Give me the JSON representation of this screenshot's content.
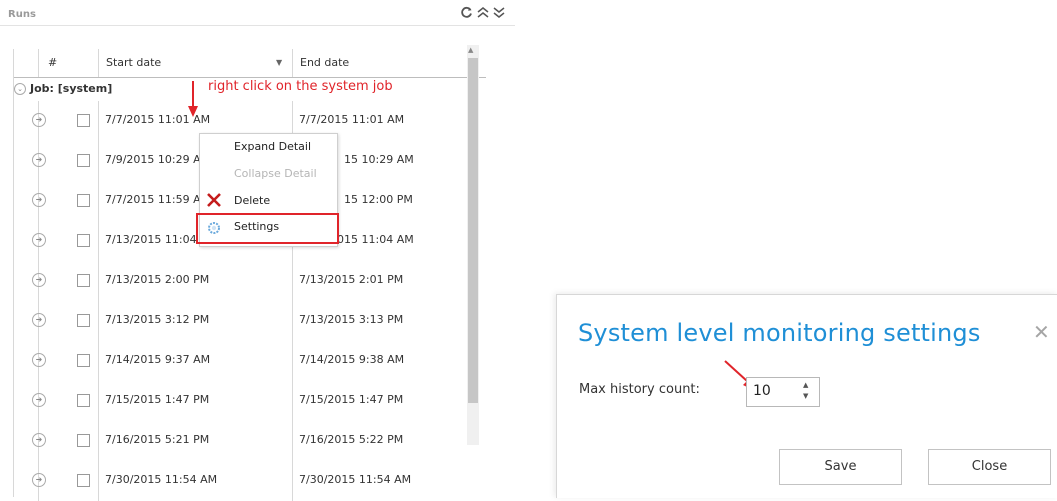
{
  "panel": {
    "title": "Runs",
    "icons": [
      "refresh-icon",
      "collapse-all-icon",
      "expand-all-icon"
    ]
  },
  "grid": {
    "columns": [
      "#",
      "Start date",
      "End date"
    ],
    "job_group_label": "Job: [system]",
    "rows": [
      {
        "start": "7/7/2015 11:01 AM",
        "end": "7/7/2015 11:01 AM"
      },
      {
        "start": "7/9/2015 10:29 A",
        "end": "15 10:29 AM"
      },
      {
        "start": "7/7/2015 11:59 A",
        "end": "15 12:00 PM"
      },
      {
        "start": "7/13/2015 11:04",
        "end": "015 11:04 AM"
      },
      {
        "start": "7/13/2015 2:00 PM",
        "end": "7/13/2015 2:01 PM"
      },
      {
        "start": "7/13/2015 3:12 PM",
        "end": "7/13/2015 3:13 PM"
      },
      {
        "start": "7/14/2015 9:37 AM",
        "end": "7/14/2015 9:38 AM"
      },
      {
        "start": "7/15/2015 1:47 PM",
        "end": "7/15/2015 1:47 PM"
      },
      {
        "start": "7/16/2015 5:21 PM",
        "end": "7/16/2015 5:22 PM"
      },
      {
        "start": "7/30/2015 11:54 AM",
        "end": "7/30/2015 11:54 AM"
      }
    ]
  },
  "context_menu": {
    "items": [
      {
        "label": "Expand Detail",
        "enabled": true
      },
      {
        "label": "Collapse Detail",
        "enabled": false
      },
      {
        "label": "Delete",
        "enabled": true,
        "icon": "delete-x-icon"
      },
      {
        "label": "Settings",
        "enabled": true,
        "icon": "settings-gear-icon"
      }
    ]
  },
  "annotation": {
    "text": "right click on the system job",
    "color": "#e0242a"
  },
  "dialog": {
    "title": "System level monitoring settings",
    "field_label": "Max history count:",
    "field_value": "10",
    "save_label": "Save",
    "close_label": "Close",
    "title_color": "#1f8fd6"
  }
}
